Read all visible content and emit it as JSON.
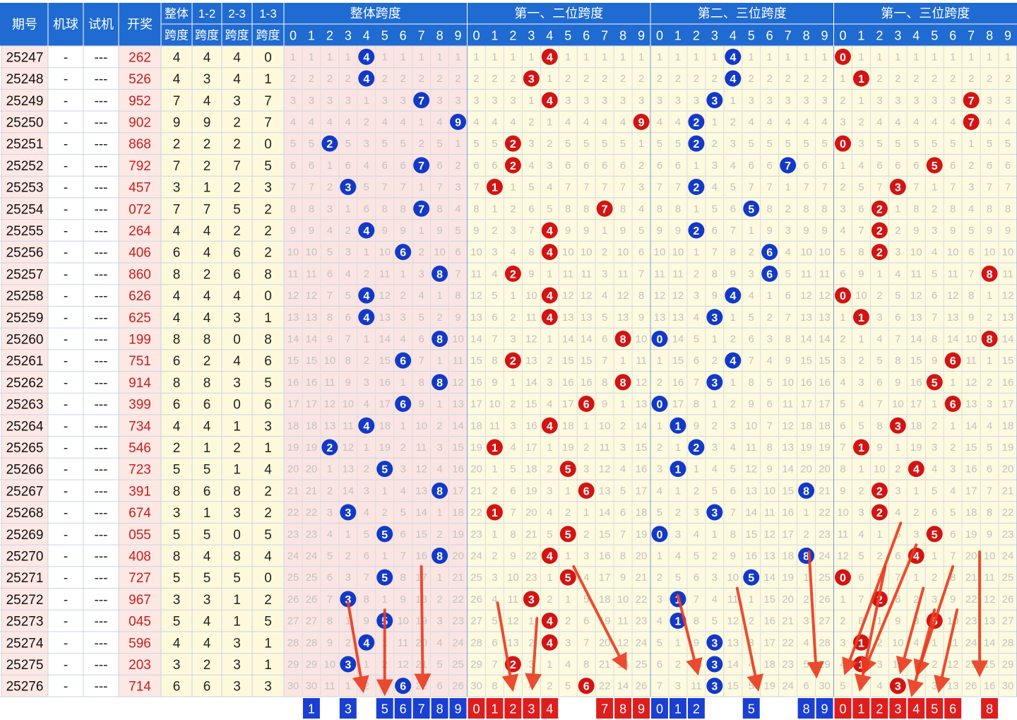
{
  "chart_data": {
    "type": "table",
    "title": "",
    "header_cols": [
      "期号",
      "机球",
      "试机",
      "开奖"
    ],
    "header_span_cols": [
      {
        "top": "整体",
        "bottom": "跨度"
      },
      {
        "top": "1-2",
        "bottom": "跨度"
      },
      {
        "top": "2-3",
        "bottom": "跨度"
      },
      {
        "top": "1-3",
        "bottom": "跨度"
      }
    ],
    "groups": [
      "整体跨度",
      "第一、二位跨度",
      "第二、三位跨度",
      "第一、三位跨度"
    ],
    "digits": [
      "0",
      "1",
      "2",
      "3",
      "4",
      "5",
      "6",
      "7",
      "8",
      "9"
    ],
    "rows": [
      {
        "issue": "25247",
        "ball": "-",
        "trial": "---",
        "draw": "262",
        "spans": [
          4,
          4,
          4,
          0
        ]
      },
      {
        "issue": "25248",
        "ball": "-",
        "trial": "---",
        "draw": "526",
        "spans": [
          4,
          3,
          4,
          1
        ]
      },
      {
        "issue": "25249",
        "ball": "-",
        "trial": "---",
        "draw": "952",
        "spans": [
          7,
          4,
          3,
          7
        ]
      },
      {
        "issue": "25250",
        "ball": "-",
        "trial": "---",
        "draw": "902",
        "spans": [
          9,
          9,
          2,
          7
        ]
      },
      {
        "issue": "25251",
        "ball": "-",
        "trial": "---",
        "draw": "868",
        "spans": [
          2,
          2,
          2,
          0
        ]
      },
      {
        "issue": "25252",
        "ball": "-",
        "trial": "---",
        "draw": "792",
        "spans": [
          7,
          2,
          7,
          5
        ]
      },
      {
        "issue": "25253",
        "ball": "-",
        "trial": "---",
        "draw": "457",
        "spans": [
          3,
          1,
          2,
          3
        ]
      },
      {
        "issue": "25254",
        "ball": "-",
        "trial": "---",
        "draw": "072",
        "spans": [
          7,
          7,
          5,
          2
        ]
      },
      {
        "issue": "25255",
        "ball": "-",
        "trial": "---",
        "draw": "264",
        "spans": [
          4,
          4,
          2,
          2
        ]
      },
      {
        "issue": "25256",
        "ball": "-",
        "trial": "---",
        "draw": "406",
        "spans": [
          6,
          4,
          6,
          2
        ]
      },
      {
        "issue": "25257",
        "ball": "-",
        "trial": "---",
        "draw": "860",
        "spans": [
          8,
          2,
          6,
          8
        ]
      },
      {
        "issue": "25258",
        "ball": "-",
        "trial": "---",
        "draw": "626",
        "spans": [
          4,
          4,
          4,
          0
        ]
      },
      {
        "issue": "25259",
        "ball": "-",
        "trial": "---",
        "draw": "625",
        "spans": [
          4,
          4,
          3,
          1
        ]
      },
      {
        "issue": "25260",
        "ball": "-",
        "trial": "---",
        "draw": "199",
        "spans": [
          8,
          8,
          0,
          8
        ]
      },
      {
        "issue": "25261",
        "ball": "-",
        "trial": "---",
        "draw": "751",
        "spans": [
          6,
          2,
          4,
          6
        ]
      },
      {
        "issue": "25262",
        "ball": "-",
        "trial": "---",
        "draw": "914",
        "spans": [
          8,
          8,
          3,
          5
        ]
      },
      {
        "issue": "25263",
        "ball": "-",
        "trial": "---",
        "draw": "399",
        "spans": [
          6,
          6,
          0,
          6
        ]
      },
      {
        "issue": "25264",
        "ball": "-",
        "trial": "---",
        "draw": "734",
        "spans": [
          4,
          4,
          1,
          3
        ]
      },
      {
        "issue": "25265",
        "ball": "-",
        "trial": "---",
        "draw": "546",
        "spans": [
          2,
          1,
          2,
          1
        ]
      },
      {
        "issue": "25266",
        "ball": "-",
        "trial": "---",
        "draw": "723",
        "spans": [
          5,
          5,
          1,
          4
        ]
      },
      {
        "issue": "25267",
        "ball": "-",
        "trial": "---",
        "draw": "391",
        "spans": [
          8,
          6,
          8,
          2
        ]
      },
      {
        "issue": "25268",
        "ball": "-",
        "trial": "---",
        "draw": "674",
        "spans": [
          3,
          1,
          3,
          2
        ]
      },
      {
        "issue": "25269",
        "ball": "-",
        "trial": "---",
        "draw": "055",
        "spans": [
          5,
          5,
          0,
          5
        ]
      },
      {
        "issue": "25270",
        "ball": "-",
        "trial": "---",
        "draw": "408",
        "spans": [
          8,
          4,
          8,
          4
        ]
      },
      {
        "issue": "25271",
        "ball": "-",
        "trial": "---",
        "draw": "727",
        "spans": [
          5,
          5,
          5,
          0
        ]
      },
      {
        "issue": "25272",
        "ball": "-",
        "trial": "---",
        "draw": "967",
        "spans": [
          3,
          3,
          1,
          2
        ]
      },
      {
        "issue": "25273",
        "ball": "-",
        "trial": "---",
        "draw": "045",
        "spans": [
          5,
          4,
          1,
          5
        ]
      },
      {
        "issue": "25274",
        "ball": "-",
        "trial": "---",
        "draw": "596",
        "spans": [
          4,
          4,
          3,
          1
        ]
      },
      {
        "issue": "25275",
        "ball": "-",
        "trial": "---",
        "draw": "203",
        "spans": [
          3,
          2,
          3,
          1
        ]
      },
      {
        "issue": "25276",
        "ball": "-",
        "trial": "---",
        "draw": "714",
        "spans": [
          6,
          6,
          3,
          3
        ]
      }
    ],
    "footer_selections": [
      [
        1,
        3,
        5,
        6,
        7,
        8,
        9
      ],
      [
        0,
        1,
        2,
        3,
        4,
        7,
        8,
        9
      ],
      [
        0,
        1,
        2,
        5,
        8,
        9
      ],
      [
        0,
        1,
        2,
        3,
        4,
        5,
        6,
        8
      ]
    ],
    "annotations": "red hand-drawn arrows pointing down to the last row",
    "colors": {
      "header_bg": "#1f6bd1",
      "ball_blue": "#1239c7",
      "ball_red": "#d21414",
      "foot_blue": "#1a3fd3",
      "foot_red": "#e01d1d",
      "pane_red": "#fbe5e2",
      "pane_yellow": "#fefadf",
      "left_pink": "#fde8e4",
      "left_yellow": "#fff9dc",
      "arrow": "#ea3a1e"
    }
  }
}
